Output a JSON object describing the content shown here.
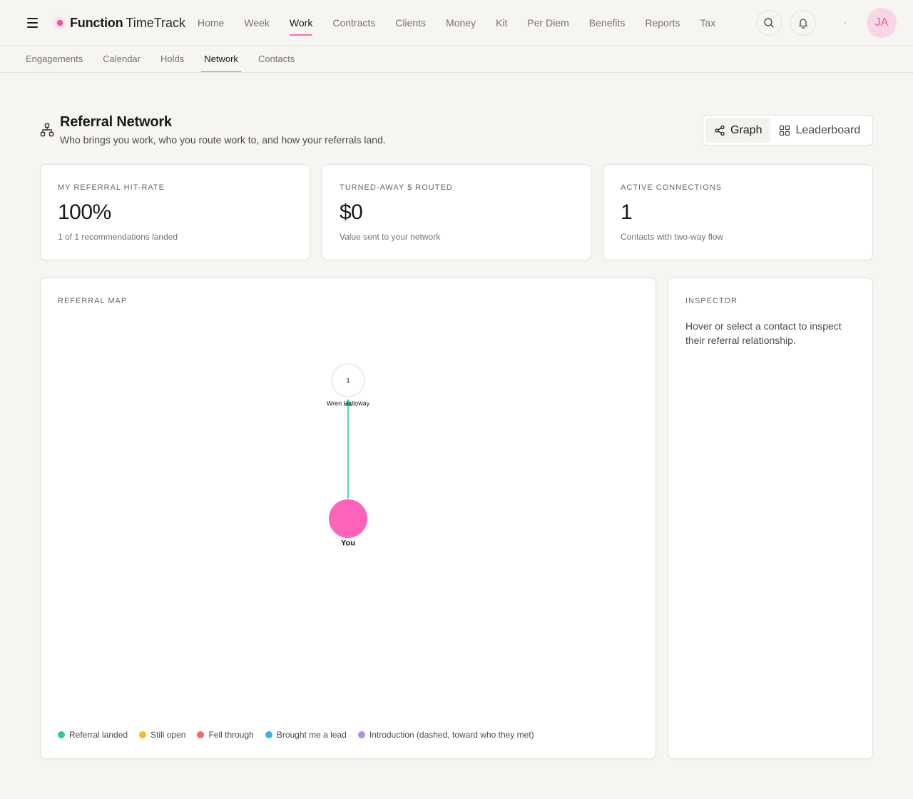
{
  "app": {
    "brand_name": "Function",
    "brand_sub": "TimeTrack",
    "avatar_initials": "JA",
    "accent": "#ee77b1"
  },
  "nav": {
    "items": [
      {
        "label": "Home",
        "name": "nav-home"
      },
      {
        "label": "Week",
        "name": "nav-week"
      },
      {
        "label": "Work",
        "name": "nav-work",
        "active": true
      },
      {
        "label": "Contracts",
        "name": "nav-contracts"
      },
      {
        "label": "Clients",
        "name": "nav-clients"
      },
      {
        "label": "Money",
        "name": "nav-money"
      },
      {
        "label": "Kit",
        "name": "nav-kit"
      },
      {
        "label": "Per Diem",
        "name": "nav-per-diem"
      },
      {
        "label": "Benefits",
        "name": "nav-benefits"
      },
      {
        "label": "Reports",
        "name": "nav-reports"
      },
      {
        "label": "Tax",
        "name": "nav-tax"
      }
    ]
  },
  "subnav": {
    "items": [
      {
        "label": "Engagements",
        "name": "tab-engagements"
      },
      {
        "label": "Calendar",
        "name": "tab-calendar"
      },
      {
        "label": "Holds",
        "name": "tab-holds"
      },
      {
        "label": "Network",
        "name": "tab-network",
        "active": true
      },
      {
        "label": "Contacts",
        "name": "tab-contacts"
      }
    ]
  },
  "header": {
    "title": "Referral Network",
    "subtitle": "Who brings you work, who you route work to, and how your referrals land.",
    "view_graph": "Graph",
    "view_leaderboard": "Leaderboard"
  },
  "stats": [
    {
      "label": "MY REFERRAL HIT-RATE",
      "value": "100%",
      "note": "1 of 1 recommendations landed"
    },
    {
      "label": "TURNED-AWAY $ ROUTED",
      "value": "$0",
      "note": "Value sent to your network"
    },
    {
      "label": "ACTIVE CONNECTIONS",
      "value": "1",
      "note": "Contacts with two-way flow"
    }
  ],
  "map": {
    "label": "REFERRAL MAP",
    "you_label": "You",
    "you_color": "#fd63b8",
    "contacts": [
      {
        "name": "Wren Halloway",
        "count": "1",
        "edge_color": "#5fd3b1"
      }
    ],
    "legend": [
      {
        "label": "Referral landed",
        "color": "#34c98e"
      },
      {
        "label": "Still open",
        "color": "#f5b82e"
      },
      {
        "label": "Fell through",
        "color": "#ef6b6b"
      },
      {
        "label": "Brought me a lead",
        "color": "#3bb3ea"
      },
      {
        "label": "Introduction (dashed, toward who they met)",
        "color": "#b88be8"
      }
    ]
  },
  "inspector": {
    "label": "INSPECTOR",
    "text": "Hover or select a contact to inspect their referral relationship."
  }
}
